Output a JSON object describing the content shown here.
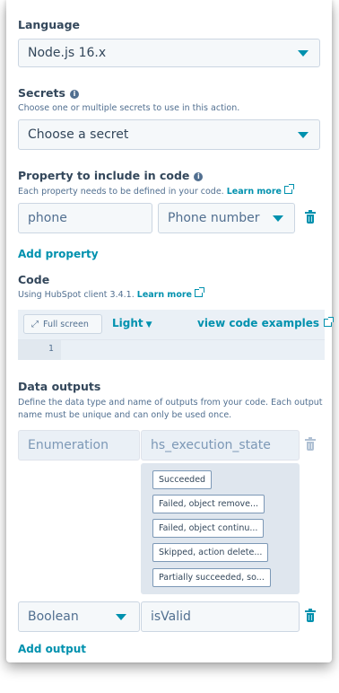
{
  "language": {
    "label": "Language",
    "value": "Node.js 16.x"
  },
  "secrets": {
    "label": "Secrets",
    "help": "Choose one or multiple secrets to use in this action.",
    "placeholder": "Choose a secret"
  },
  "property": {
    "label": "Property to include in code",
    "help": "Each property needs to be defined in your code.",
    "learn_more": "Learn more",
    "key_value": "phone",
    "property_value": "Phone number",
    "add_label": "Add property"
  },
  "code": {
    "label": "Code",
    "help": "Using HubSpot client 3.4.1.",
    "learn_more": "Learn more",
    "fullscreen_label": "Full screen",
    "theme_label": "Light",
    "examples_label": "view code examples",
    "line_number": "1"
  },
  "outputs": {
    "label": "Data outputs",
    "help_line1": "Define the data type and name of outputs from your code. Each output",
    "help_line2": "name must be unique and can only be used once.",
    "rows": [
      {
        "type": "Enumeration",
        "name": "hs_execution_state"
      },
      {
        "type": "Boolean",
        "name": "isValid"
      }
    ],
    "options": [
      "Succeeded",
      "Failed, object remove...",
      "Failed, object continu...",
      "Skipped, action delete...",
      "Partially succeeded, so..."
    ],
    "add_label": "Add output"
  },
  "colors": {
    "accent": "#0091ae",
    "text": "#33475b",
    "input_bg": "#f5f8fa",
    "border": "#cbd6e2"
  }
}
